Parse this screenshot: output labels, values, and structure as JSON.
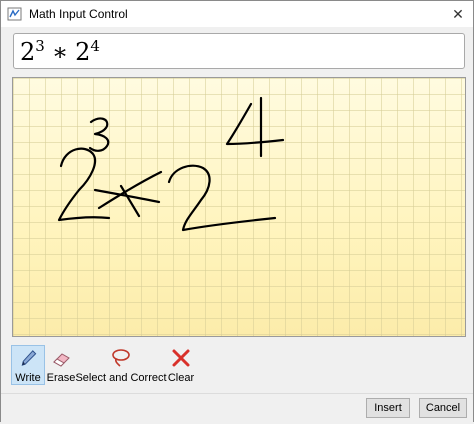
{
  "window": {
    "title": "Math Input Control",
    "close_glyph": "✕"
  },
  "preview": {
    "base1": "2",
    "exp1": "3",
    "operator": "∗",
    "base2": "2",
    "exp2": "4"
  },
  "toolbar": {
    "write_label": "Write",
    "erase_label": "Erase",
    "select_correct_label": "Select and Correct",
    "clear_label": "Clear",
    "active_tool": "write"
  },
  "buttons": {
    "insert_label": "Insert",
    "cancel_label": "Cancel"
  },
  "icons": {
    "title": "math-input-icon",
    "write": "pen-icon",
    "erase": "eraser-icon",
    "select_correct": "lasso-icon",
    "clear": "red-x-icon"
  },
  "colors": {
    "ink": "#000000",
    "canvas": "#fff6c4",
    "active_tool_bg": "#cce4f7",
    "clear_icon": "#d9302a"
  }
}
